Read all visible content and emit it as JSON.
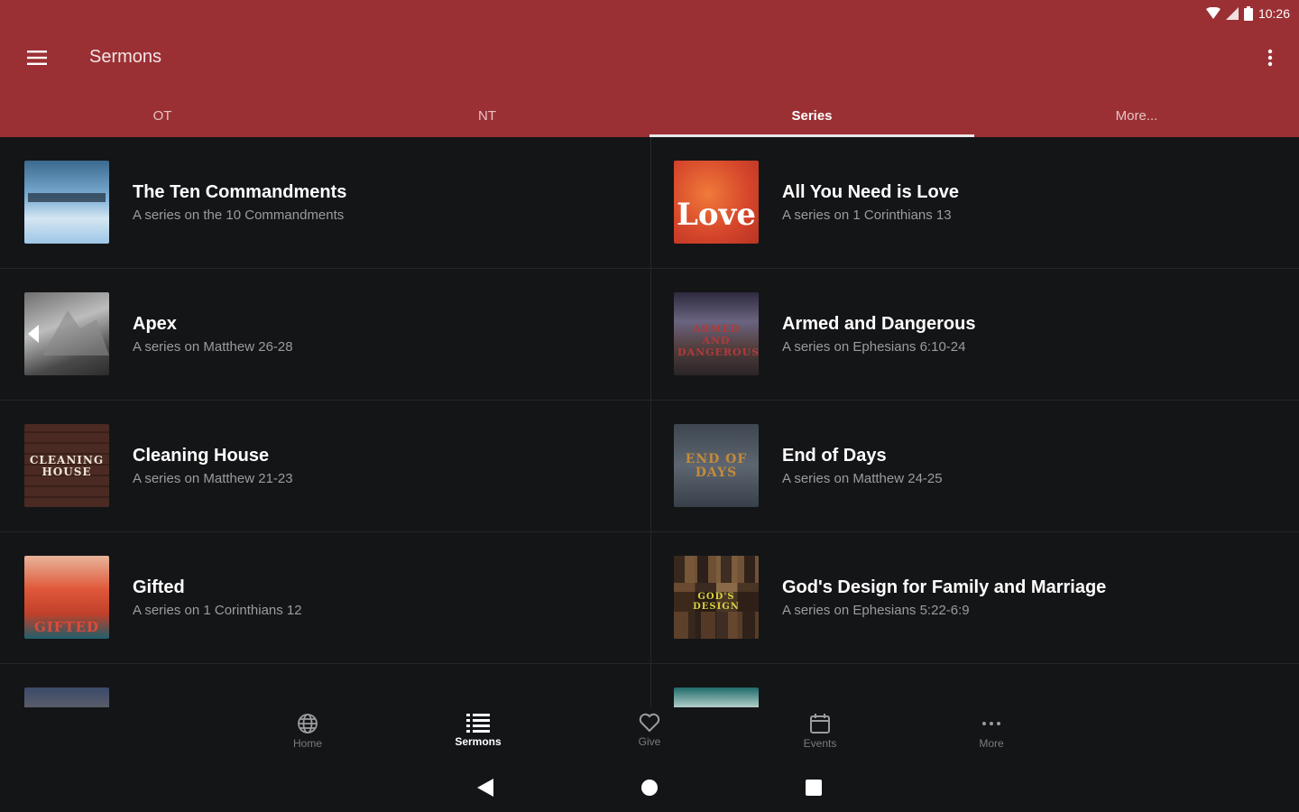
{
  "status_bar": {
    "time": "10:26",
    "icons": [
      "wifi-icon",
      "cell-signal-icon",
      "battery-icon"
    ]
  },
  "app_bar": {
    "title": "Sermons",
    "menu_icon": "hamburger-icon",
    "overflow_icon": "more-vertical-icon",
    "color": "#9b3034"
  },
  "tabs": [
    {
      "label": "OT",
      "active": false
    },
    {
      "label": "NT",
      "active": false
    },
    {
      "label": "Series",
      "active": true
    },
    {
      "label": "More...",
      "active": false
    }
  ],
  "series": [
    {
      "title": "The Ten Commandments",
      "subtitle": "A series on the 10 Commandments",
      "thumb_text": ""
    },
    {
      "title": "All You Need is Love",
      "subtitle": "A series on 1 Corinthians 13",
      "thumb_text": "Love"
    },
    {
      "title": "Apex",
      "subtitle": "A series on Matthew 26-28",
      "thumb_text": ""
    },
    {
      "title": "Armed and Dangerous",
      "subtitle": "A series on Ephesians 6:10-24",
      "thumb_text": "ARMED AND DANGEROUS"
    },
    {
      "title": "Cleaning House",
      "subtitle": "A series on Matthew 21-23",
      "thumb_text": "CLEANING HOUSE"
    },
    {
      "title": "End of Days",
      "subtitle": "A series on Matthew 24-25",
      "thumb_text": "END OF DAYS"
    },
    {
      "title": "Gifted",
      "subtitle": "A series on 1 Corinthians 12",
      "thumb_text": "GIFTED"
    },
    {
      "title": "God's Design for Family and Marriage",
      "subtitle": "A series on Ephesians 5:22-6:9",
      "thumb_text": "GOD'S DESIGN"
    }
  ],
  "bottom_nav": [
    {
      "label": "Home",
      "icon": "globe-icon",
      "active": false
    },
    {
      "label": "Sermons",
      "icon": "list-icon",
      "active": true
    },
    {
      "label": "Give",
      "icon": "heart-icon",
      "active": false
    },
    {
      "label": "Events",
      "icon": "calendar-icon",
      "active": false
    },
    {
      "label": "More",
      "icon": "more-horizontal-icon",
      "active": false
    }
  ],
  "system_nav": [
    "back-icon",
    "home-icon",
    "recents-icon"
  ]
}
